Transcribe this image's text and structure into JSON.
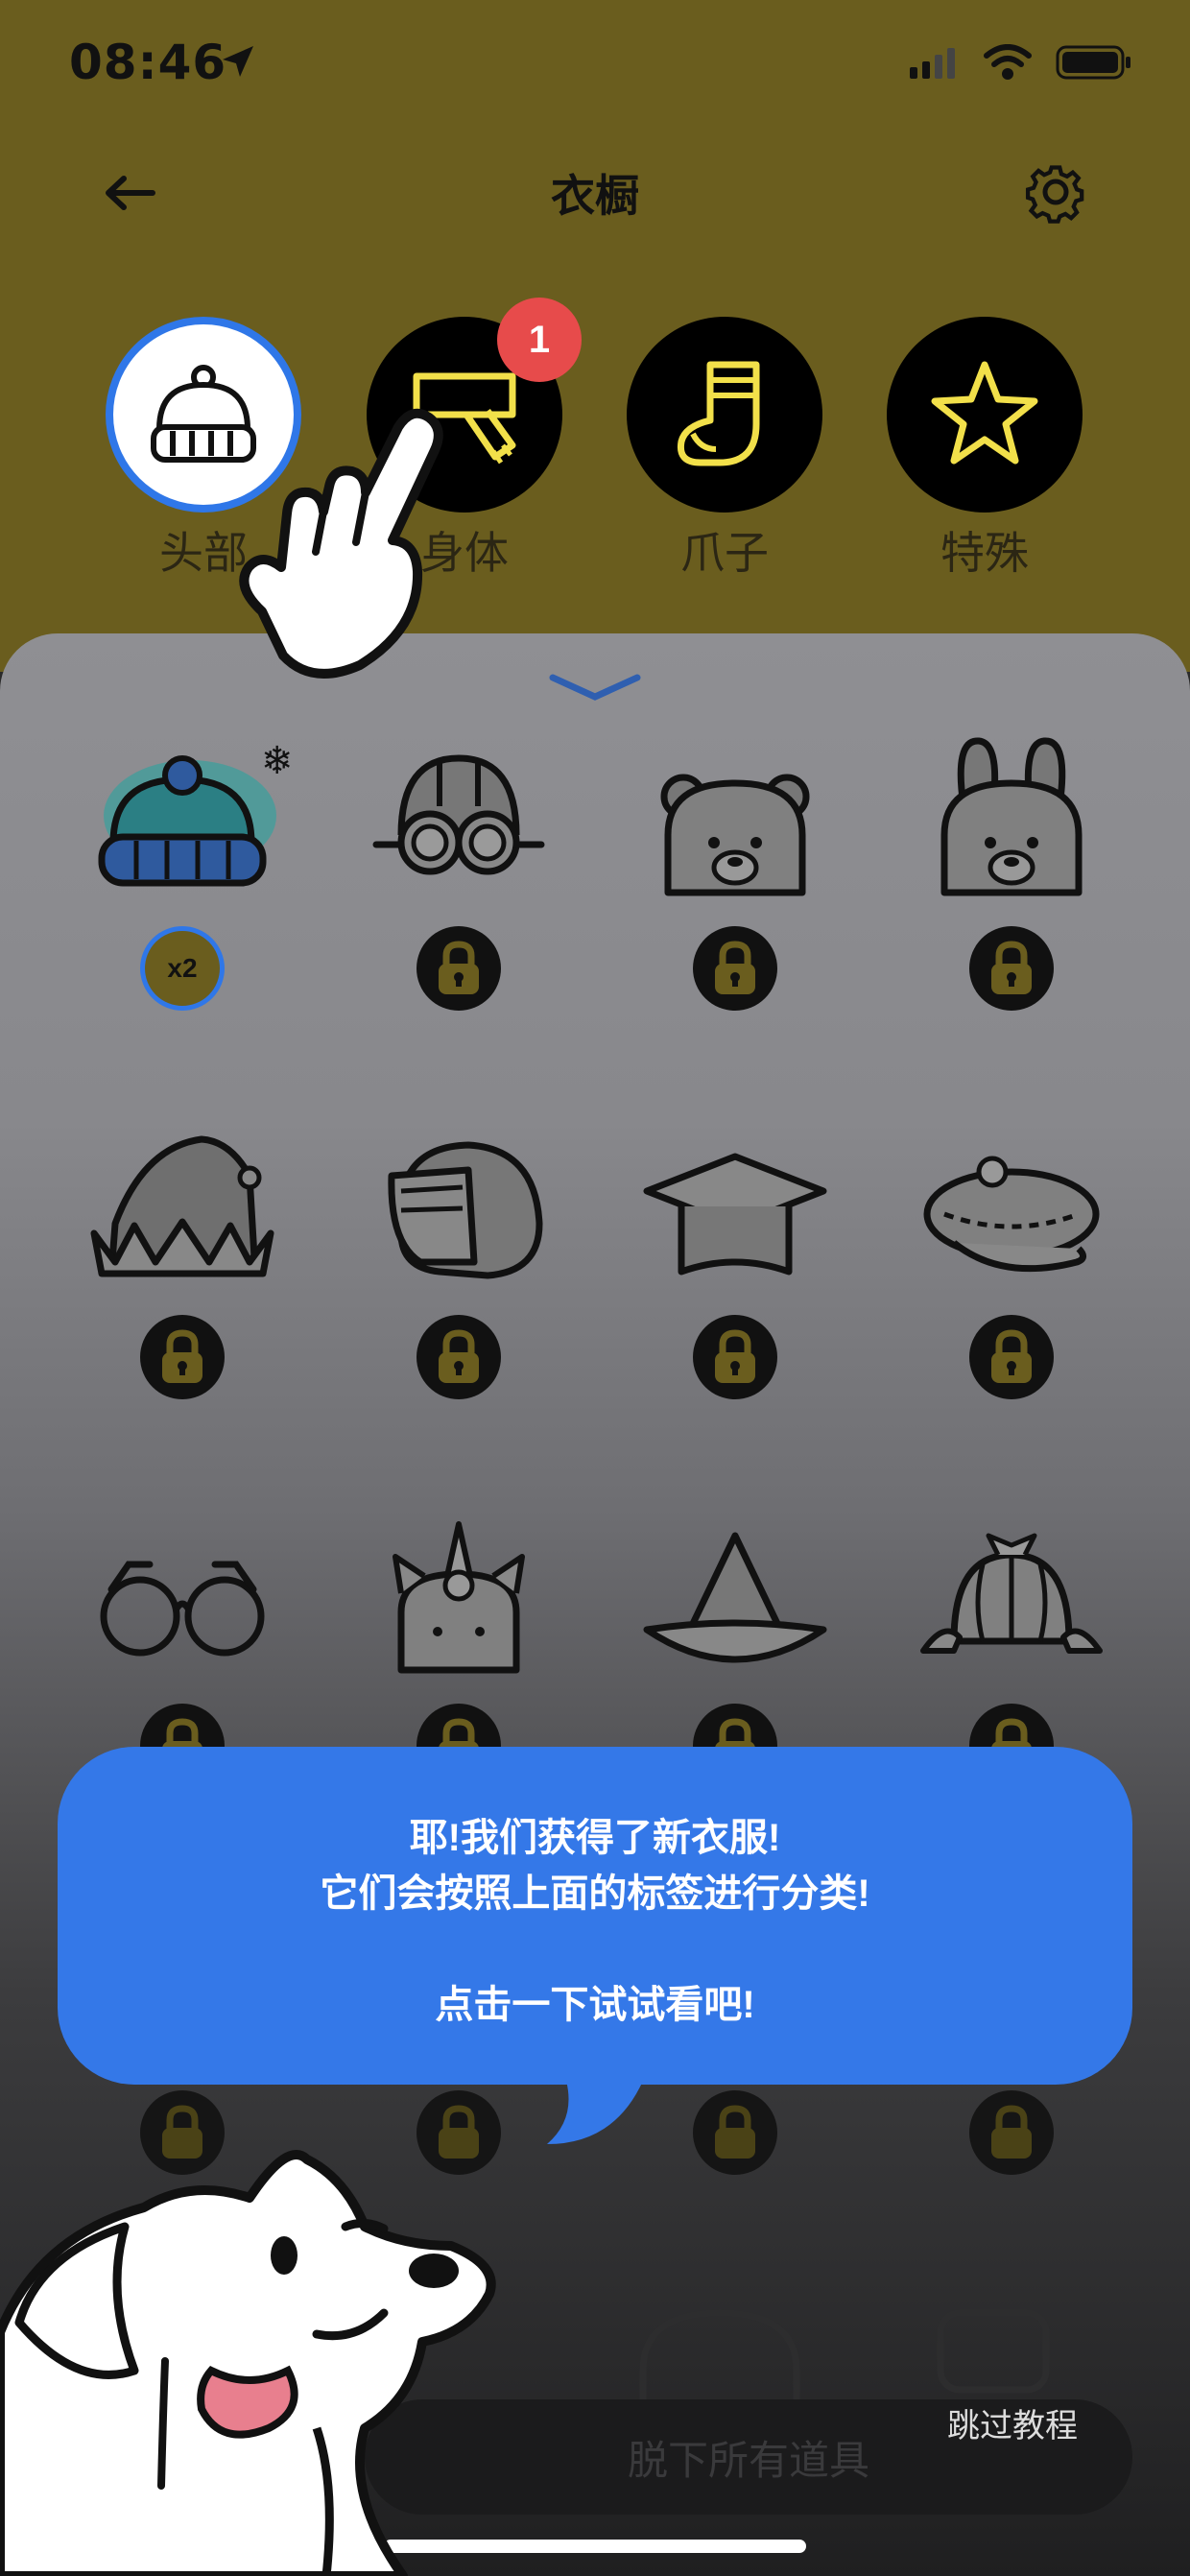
{
  "status_bar": {
    "time": "08:46"
  },
  "header": {
    "title": "衣橱",
    "back_icon": "arrow-left-icon",
    "settings_icon": "gear-icon"
  },
  "tabs": [
    {
      "label": "头部",
      "icon": "beanie-icon",
      "active": true
    },
    {
      "label": "身体",
      "icon": "scarf-icon",
      "badge": "1"
    },
    {
      "label": "爪子",
      "icon": "sock-icon"
    },
    {
      "label": "特殊",
      "icon": "star-icon"
    }
  ],
  "items": {
    "first": {
      "icon": "beanie-hat-icon",
      "quantity": "x2",
      "snowflake": "❄"
    },
    "locked": [
      "aviator-helmet-icon",
      "bear-ears-icon",
      "bunny-ears-icon",
      "jester-hat-icon",
      "motorcycle-helmet-icon",
      "graduation-cap-icon",
      "beret-icon",
      "glasses-icon",
      "unicorn-hat-icon",
      "witch-hat-icon",
      "detective-hat-icon"
    ]
  },
  "tutorial": {
    "line1": "耶!我们获得了新衣服!",
    "line2": "它们会按照上面的标签进行分类!",
    "line3": "点击一下试试看吧!"
  },
  "bottom": {
    "remove_all": "脱下所有道具",
    "skip": "跳过教程"
  },
  "colors": {
    "olive": "#6a5d1e",
    "accent_blue": "#3478e8",
    "badge_red": "#e74b4b",
    "icon_yellow": "#f2e04a"
  }
}
